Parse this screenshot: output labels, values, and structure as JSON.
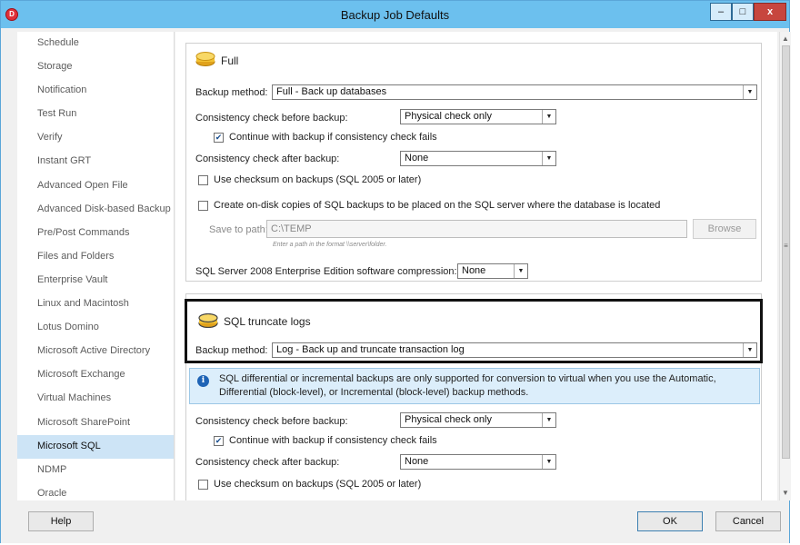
{
  "window": {
    "title": "Backup Job Defaults",
    "app_icon_glyph": "D",
    "controls": {
      "minimize": "–",
      "maximize": "□",
      "close": "x"
    }
  },
  "sidebar": {
    "selected_index": 18,
    "items": [
      {
        "label": "Schedule"
      },
      {
        "label": "Storage"
      },
      {
        "label": "Notification"
      },
      {
        "label": "Test Run"
      },
      {
        "label": "Verify"
      },
      {
        "label": "Instant GRT"
      },
      {
        "label": "Advanced Open File"
      },
      {
        "label": "Advanced Disk-based Backup"
      },
      {
        "label": "Pre/Post Commands"
      },
      {
        "label": "Files and Folders"
      },
      {
        "label": "Enterprise Vault"
      },
      {
        "label": "Linux and Macintosh"
      },
      {
        "label": "Lotus Domino"
      },
      {
        "label": "Microsoft Active Directory"
      },
      {
        "label": "Microsoft Exchange"
      },
      {
        "label": "Virtual Machines"
      },
      {
        "label": "Microsoft SharePoint"
      },
      {
        "label": "Microsoft SQL"
      },
      {
        "label": "NDMP"
      },
      {
        "label": "Oracle"
      }
    ]
  },
  "full": {
    "header": "Full",
    "backup_method_label": "Backup method:",
    "backup_method_value": "Full - Back up databases",
    "consistency_before_label": "Consistency check before backup:",
    "consistency_before_value": "Physical check only",
    "continue_label": "Continue with backup if consistency check fails",
    "continue_checked": true,
    "consistency_after_label": "Consistency check after backup:",
    "consistency_after_value": "None",
    "checksum_label": "Use checksum on backups (SQL 2005 or later)",
    "checksum_checked": false,
    "ondisk_label": "Create on-disk copies of SQL backups to be placed on the SQL server where the database is located",
    "ondisk_checked": false,
    "save_path_label": "Save to path:",
    "save_path_value": "C:\\TEMP",
    "browse_label": "Browse",
    "path_hint": "Enter a path in the format \\\\server\\folder.",
    "compression_label": "SQL Server 2008 Enterprise Edition software compression:",
    "compression_value": "None"
  },
  "truncate": {
    "header": "SQL truncate logs",
    "backup_method_label": "Backup method:",
    "backup_method_value": "Log - Back up and truncate transaction log",
    "info_text": "SQL differential or incremental backups are only supported for conversion to virtual when you use the Automatic, Differential (block-level), or Incremental (block-level) backup methods.",
    "consistency_before_label": "Consistency check before backup:",
    "consistency_before_value": "Physical check only",
    "continue_label": "Continue with backup if consistency check fails",
    "continue_checked": true,
    "consistency_after_label": "Consistency check after backup:",
    "consistency_after_value": "None",
    "checksum_label": "Use checksum on backups (SQL 2005 or later)",
    "checksum_checked": false
  },
  "footer": {
    "help_label": "Help",
    "ok_label": "OK",
    "cancel_label": "Cancel"
  },
  "colors": {
    "titlebar": "#6cc0ee",
    "selected_item": "#cde4f6",
    "info_background": "#dceefb",
    "close_button": "#c7463e",
    "db_icon": "#f2c132"
  }
}
